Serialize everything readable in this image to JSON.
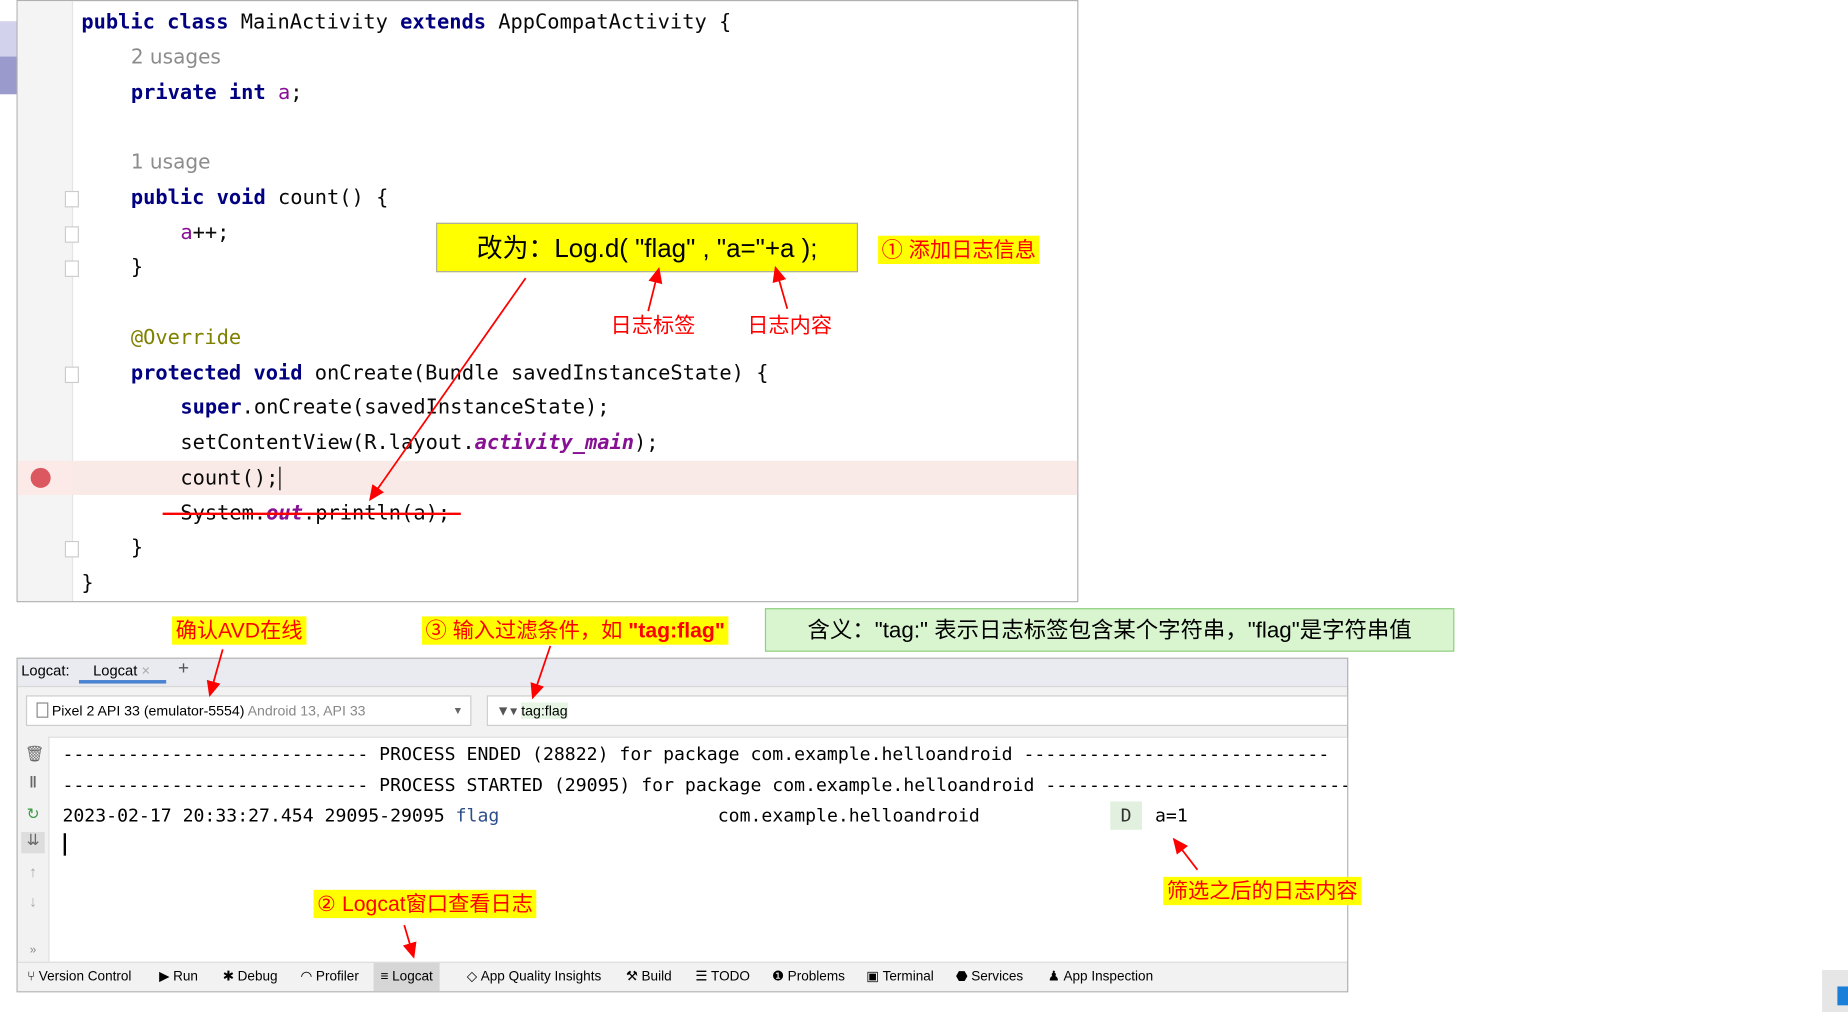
{
  "editor": {
    "lines": {
      "l1": {
        "kw": "public class ",
        "name": "MainActivity ",
        "kw2": "extends ",
        "rest": "AppCompatActivity {"
      },
      "hint1": "2 usages",
      "l2": {
        "kw": "private int ",
        "fld": "a",
        "rest": ";"
      },
      "hint2": "1 usage",
      "l3": {
        "kw": "public void ",
        "rest": "count() {"
      },
      "l4": {
        "fld": "a",
        "rest": "++;"
      },
      "l5": "}",
      "l6": "@Override",
      "l7": {
        "kw": "protected void ",
        "rest": "onCreate(Bundle savedInstanceState) {"
      },
      "l8": {
        "kw": "super",
        "rest": ".onCreate(savedInstanceState);"
      },
      "l9": {
        "pre": "setContentView(R.layout.",
        "ital": "activity_main",
        "post": ");"
      },
      "l10": "count();",
      "l11": {
        "pre": "System.",
        "ital": "out",
        "post": ".println(a);"
      },
      "l12": "}",
      "l13": "}"
    },
    "breakpoint_color": "#db5860"
  },
  "annotations": {
    "replace_box": "改为：Log.d( \"flag\" , \"a=\"+a );",
    "step1": "① 添加日志信息",
    "tag_label": "日志标签",
    "content_label": "日志内容",
    "avd_online": "确认AVD在线",
    "step3_prefix": "③ 输入过滤条件，如 ",
    "step3_bold": "\"tag:flag\"",
    "meaning": "含义：\"tag:\" 表示日志标签包含某个字符串，\"flag\"是字符串值",
    "step2": "② Logcat窗口查看日志",
    "filtered": "筛选之后的日志内容"
  },
  "logcat": {
    "tab_prefix": "Logcat:",
    "tab": "Logcat",
    "device": "Pixel 2 API 33 (emulator-5554)",
    "device_info": "Android 13, API 33",
    "filter": "tag:flag",
    "lines": {
      "ended": "---------------------------- PROCESS ENDED (28822) for package com.example.helloandroid ----------------------------",
      "started": "---------------------------- PROCESS STARTED (29095) for package com.example.helloandroid ----------------------------",
      "entry": {
        "time": "2023-02-17 20:33:27.454 29095-29095 ",
        "tag": "flag",
        "package": "com.example.helloandroid",
        "level": "D",
        "message": "a=1"
      }
    }
  },
  "bottombar": [
    {
      "label": "Version Control",
      "icon": "branch-icon"
    },
    {
      "label": "Run",
      "icon": "run-icon"
    },
    {
      "label": "Debug",
      "icon": "bug-icon"
    },
    {
      "label": "Profiler",
      "icon": "gauge-icon"
    },
    {
      "label": "Logcat",
      "icon": "list-icon"
    },
    {
      "label": "App Quality Insights",
      "icon": "diamond-icon"
    },
    {
      "label": "Build",
      "icon": "hammer-icon"
    },
    {
      "label": "TODO",
      "icon": "checklist-icon"
    },
    {
      "label": "Problems",
      "icon": "warning-icon"
    },
    {
      "label": "Terminal",
      "icon": "terminal-icon"
    },
    {
      "label": "Services",
      "icon": "services-icon"
    },
    {
      "label": "App Inspection",
      "icon": "inspect-icon"
    }
  ]
}
